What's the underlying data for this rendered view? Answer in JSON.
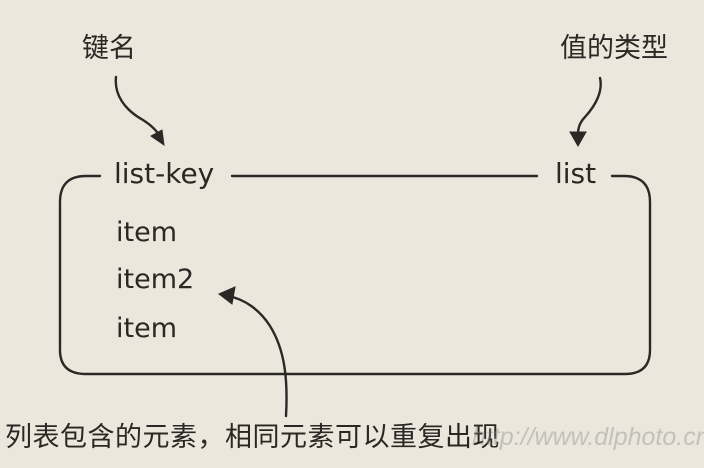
{
  "diagram": {
    "callouts": {
      "key_name": "键名",
      "value_type": "值的类型",
      "note": "列表包含的元素，相同元素可以重复出现"
    },
    "list": {
      "key": "list-key",
      "type": "list",
      "items": [
        "item",
        "item2",
        "item"
      ]
    },
    "watermark": "http://www.dlphoto.cn"
  }
}
